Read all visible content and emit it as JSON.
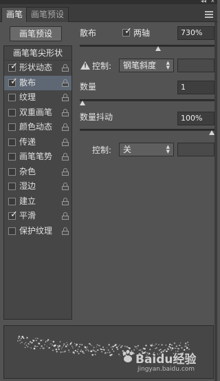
{
  "tabs": [
    {
      "label": "画笔"
    },
    {
      "label": "画笔预设"
    }
  ],
  "preset_button": "画笔预设",
  "left_panel": {
    "header": "画笔笔尖形状",
    "items": [
      {
        "label": "形状动态",
        "checked": true
      },
      {
        "label": "散布",
        "checked": true
      },
      {
        "label": "纹理",
        "checked": false
      },
      {
        "label": "双重画笔",
        "checked": false
      },
      {
        "label": "颜色动态",
        "checked": false
      },
      {
        "label": "传递",
        "checked": false
      },
      {
        "label": "画笔笔势",
        "checked": false
      },
      {
        "label": "杂色",
        "checked": false
      },
      {
        "label": "湿边",
        "checked": false
      },
      {
        "label": "建立",
        "checked": false
      },
      {
        "label": "平滑",
        "checked": true
      },
      {
        "label": "保护纹理",
        "checked": false
      }
    ],
    "active_item": "散布"
  },
  "scatter": {
    "label": "散布",
    "both_axes_label": "两轴",
    "both_axes_checked": true,
    "value": "730%",
    "slider_fraction": 0.73,
    "control_label": "控制:",
    "control_value": "钢笔斜度"
  },
  "count": {
    "label": "数量",
    "value": "1",
    "slider_fraction": 0.0
  },
  "count_jitter": {
    "label": "数量抖动",
    "value": "100%",
    "slider_fraction": 1.0,
    "control_label": "控制:",
    "control_value": "关"
  },
  "watermark": {
    "brand": "Baidu经验",
    "url": "jingyan.baidu.com"
  },
  "colors": {
    "panel_bg": "#535353",
    "active_row": "#5e6875"
  },
  "icons": {
    "lock": "lock-icon",
    "warning": "warning-icon",
    "menu": "panel-menu-icon",
    "checkbox": "checkbox-icon"
  }
}
